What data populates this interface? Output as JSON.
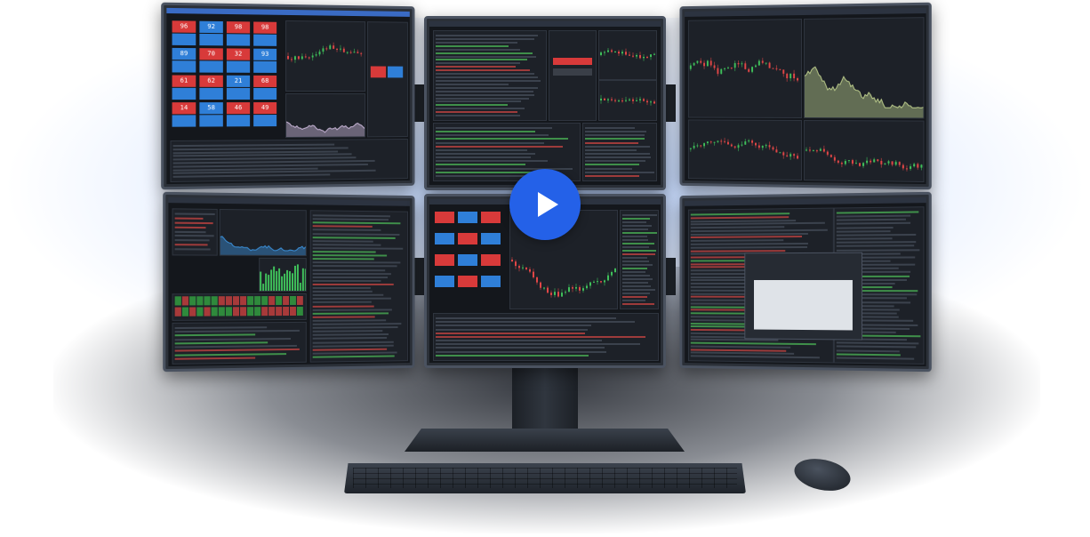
{
  "scene": {
    "accent": "#2461e8",
    "screen_bg": "#14171c"
  },
  "play_button": {
    "icon": "play-icon"
  },
  "tiles": {
    "values": [
      "96",
      "92",
      "98",
      "98",
      "89",
      "70",
      "32",
      "93",
      "61",
      "62",
      "21",
      "68",
      "14",
      "58",
      "46",
      "49"
    ]
  },
  "monitor_count": 6
}
